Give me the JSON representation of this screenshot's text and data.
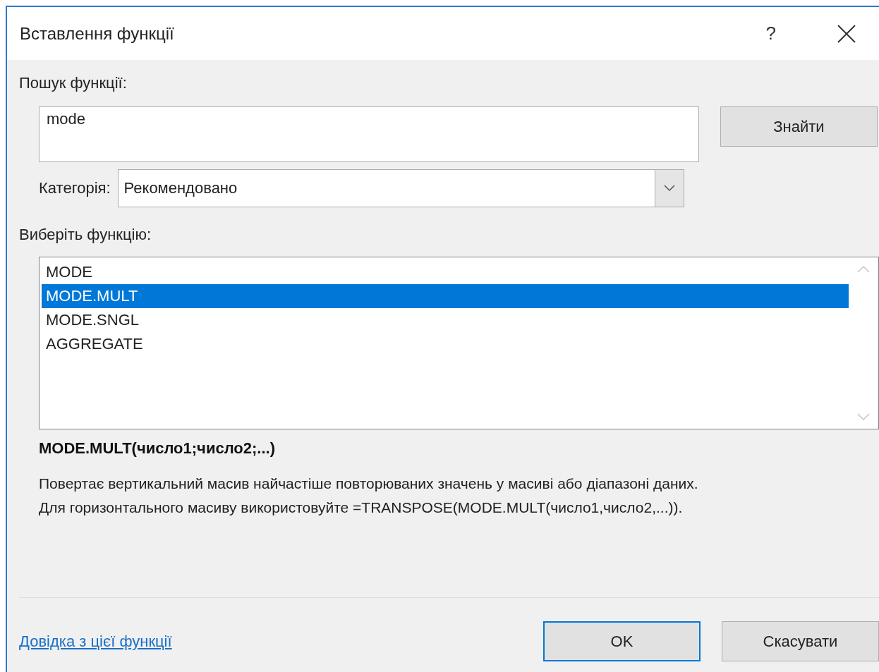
{
  "window": {
    "title": "Вставлення функції",
    "help": "?"
  },
  "search": {
    "label": "Пошук функції:",
    "value": "mode",
    "button": "Знайти"
  },
  "category": {
    "label": "Категорія:",
    "value": "Рекомендовано"
  },
  "function_list": {
    "label": "Виберіть функцію:",
    "items": [
      {
        "label": "MODE",
        "selected": false
      },
      {
        "label": "MODE.MULT",
        "selected": true
      },
      {
        "label": "MODE.SNGL",
        "selected": false
      },
      {
        "label": "AGGREGATE",
        "selected": false
      }
    ]
  },
  "signature": "MODE.MULT(число1;число2;...)",
  "description": "Повертає вертикальний масив найчастіше повторюваних значень у масиві або діапазоні даних.\nДля горизонтального масиву використовуйте =TRANSPOSE(MODE.MULT(число1,число2,...)).",
  "help_link": "Довідка з цієї функції",
  "buttons": [
    {
      "label": "OK",
      "default": true
    },
    {
      "label": "Скасувати",
      "default": false
    }
  ]
}
